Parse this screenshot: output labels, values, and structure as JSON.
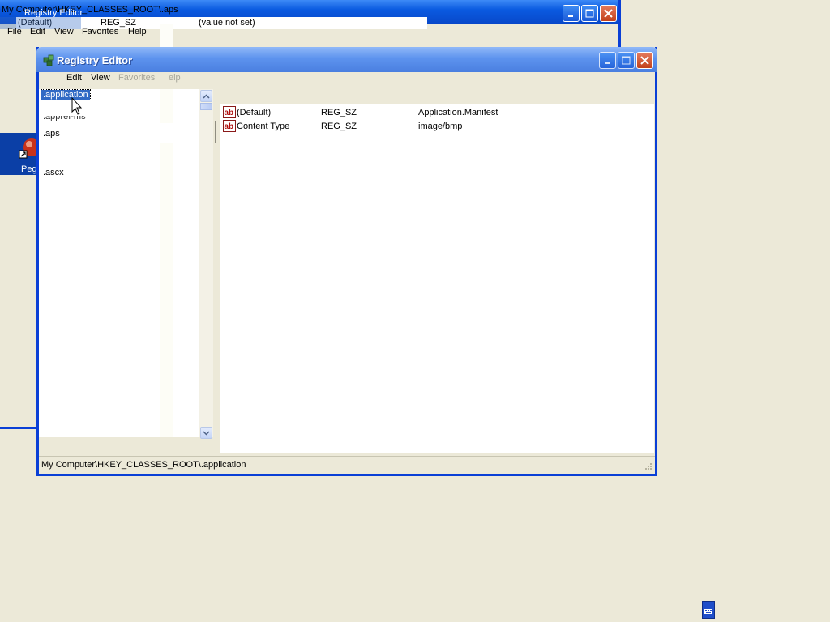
{
  "background_window": {
    "title": "My Computer\\HKEY_CLASSES_ROOT\\.aps",
    "title_echo": "Registry Editor",
    "menus": [
      "File",
      "Edit",
      "View",
      "Favorites",
      "Help"
    ],
    "row": {
      "name": "(Default)",
      "type": "REG_SZ",
      "data": "(value not set)"
    }
  },
  "desktop_icon": {
    "label": "Peg"
  },
  "window": {
    "title": "Registry Editor",
    "menus": [
      {
        "label": "Edit",
        "enabled": true
      },
      {
        "label": "View",
        "enabled": true
      },
      {
        "label": "Favorites",
        "enabled": false
      },
      {
        "label": "elp",
        "enabled": false
      }
    ]
  },
  "tree": {
    "items": [
      ".application",
      ".appref-ms",
      ".aps",
      ".ascx"
    ],
    "selected": ".application"
  },
  "values": {
    "rows": [
      {
        "name": "(Default)",
        "type": "REG_SZ",
        "data": "Application.Manifest",
        "icon": "reg-string-icon"
      },
      {
        "name": "Content Type",
        "type": "REG_SZ",
        "data": "image/bmp",
        "icon": "reg-string-icon"
      }
    ]
  },
  "status": {
    "path": "My Computer\\HKEY_CLASSES_ROOT\\.application"
  },
  "colors": {
    "xp_blue": "#0a3fd6",
    "selection": "#316ac5",
    "window_face": "#ece9d8"
  }
}
